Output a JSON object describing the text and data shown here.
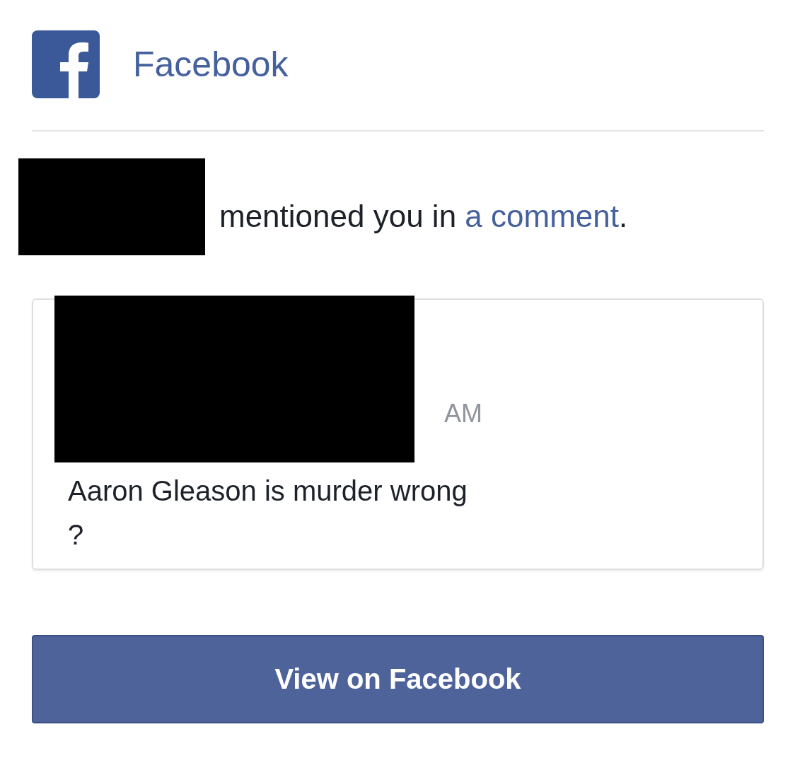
{
  "header": {
    "title": "Facebook"
  },
  "notice": {
    "text": "mentioned you in",
    "link": "a comment",
    "end": "."
  },
  "comment": {
    "time": "AM",
    "text": "Aaron Gleason is murder wrong\n?"
  },
  "button": {
    "label": "View on Facebook"
  }
}
